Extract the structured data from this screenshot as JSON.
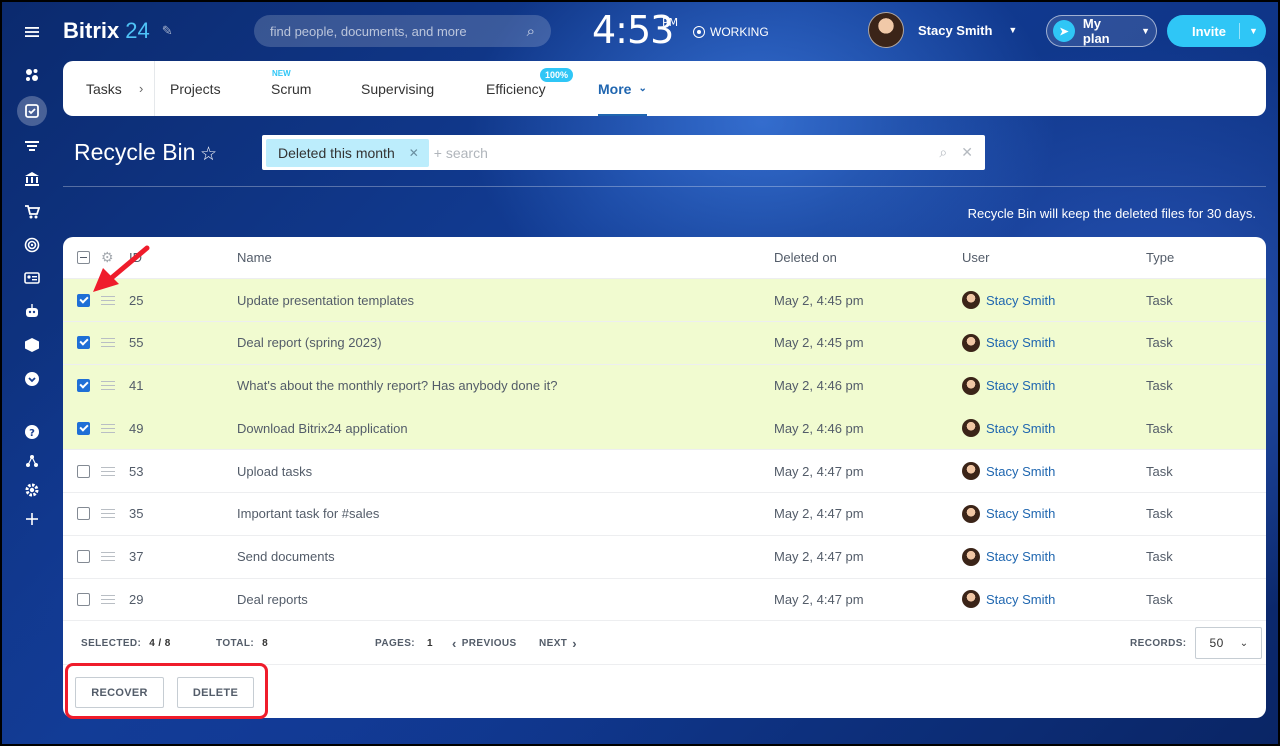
{
  "brand": {
    "name": "Bitrix",
    "num": "24"
  },
  "search": {
    "placeholder": "find people, documents, and more"
  },
  "clock": {
    "time": "4:53",
    "ampm": "PM"
  },
  "status": {
    "label": "WORKING"
  },
  "user": {
    "name": "Stacy Smith"
  },
  "plan": {
    "label": "My plan"
  },
  "invite": {
    "label": "Invite"
  },
  "nav": {
    "tasks": "Tasks",
    "projects": "Projects",
    "scrum": "Scrum",
    "scrum_badge": "NEW",
    "supervising": "Supervising",
    "efficiency": "Efficiency",
    "efficiency_badge": "100%",
    "more": "More"
  },
  "page": {
    "title": "Recycle Bin",
    "notice": "Recycle Bin will keep the deleted files for 30 days."
  },
  "filter": {
    "chip": "Deleted this month",
    "placeholder": "+ search"
  },
  "grid": {
    "columns": {
      "id": "ID",
      "name": "Name",
      "deleted_on": "Deleted on",
      "user": "User",
      "type": "Type"
    },
    "rows": [
      {
        "id": "25",
        "name": "Update presentation templates",
        "deleted_on": "May 2, 4:45 pm",
        "user": "Stacy Smith",
        "type": "Task",
        "checked": true
      },
      {
        "id": "55",
        "name": "Deal report (spring 2023)",
        "deleted_on": "May 2, 4:45 pm",
        "user": "Stacy Smith",
        "type": "Task",
        "checked": true
      },
      {
        "id": "41",
        "name": "What's about the monthly report? Has anybody done it?",
        "deleted_on": "May 2, 4:46 pm",
        "user": "Stacy Smith",
        "type": "Task",
        "checked": true
      },
      {
        "id": "49",
        "name": "Download Bitrix24 application",
        "deleted_on": "May 2, 4:46 pm",
        "user": "Stacy Smith",
        "type": "Task",
        "checked": true
      },
      {
        "id": "53",
        "name": "Upload tasks",
        "deleted_on": "May 2, 4:47 pm",
        "user": "Stacy Smith",
        "type": "Task",
        "checked": false
      },
      {
        "id": "35",
        "name": "Important task for #sales",
        "deleted_on": "May 2, 4:47 pm",
        "user": "Stacy Smith",
        "type": "Task",
        "checked": false
      },
      {
        "id": "37",
        "name": "Send documents",
        "deleted_on": "May 2, 4:47 pm",
        "user": "Stacy Smith",
        "type": "Task",
        "checked": false
      },
      {
        "id": "29",
        "name": "Deal reports",
        "deleted_on": "May 2, 4:47 pm",
        "user": "Stacy Smith",
        "type": "Task",
        "checked": false
      }
    ]
  },
  "footer": {
    "selected_label": "SELECTED:",
    "selected_value": "4 / 8",
    "total_label": "TOTAL:",
    "total_value": "8",
    "pages_label": "PAGES:",
    "pages_value": "1",
    "previous": "PREVIOUS",
    "next": "NEXT",
    "records_label": "RECORDS:",
    "records_value": "50"
  },
  "actions": {
    "recover": "RECOVER",
    "delete": "DELETE"
  },
  "colors": {
    "accent": "#2fc6f6",
    "link": "#2067b0",
    "selected_row": "#f1fbd0",
    "annotation": "#ef1c2b"
  }
}
